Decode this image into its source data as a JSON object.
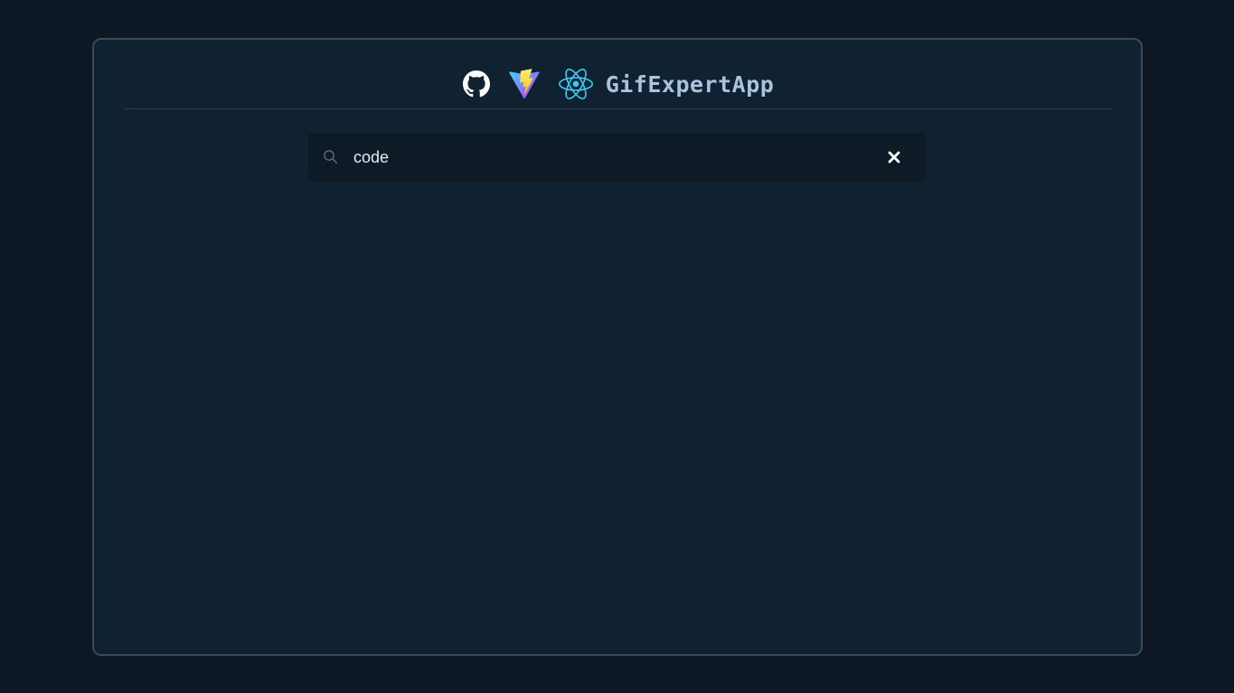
{
  "header": {
    "title": "GifExpertApp",
    "icons": [
      "github-icon",
      "vite-icon",
      "react-icon"
    ]
  },
  "search": {
    "value": "code",
    "placeholder": "",
    "icon": "search-icon",
    "clear_icon": "close-icon"
  },
  "colors": {
    "page_background": "#0e1824",
    "card_background": "#102131",
    "card_border": "#3a4a5c",
    "title": "#a8c4dc",
    "search_background": "#0e1a26",
    "react_blue": "#3fc6f0",
    "vite_purple": "#9b5cff",
    "vite_yellow": "#ffc517"
  }
}
